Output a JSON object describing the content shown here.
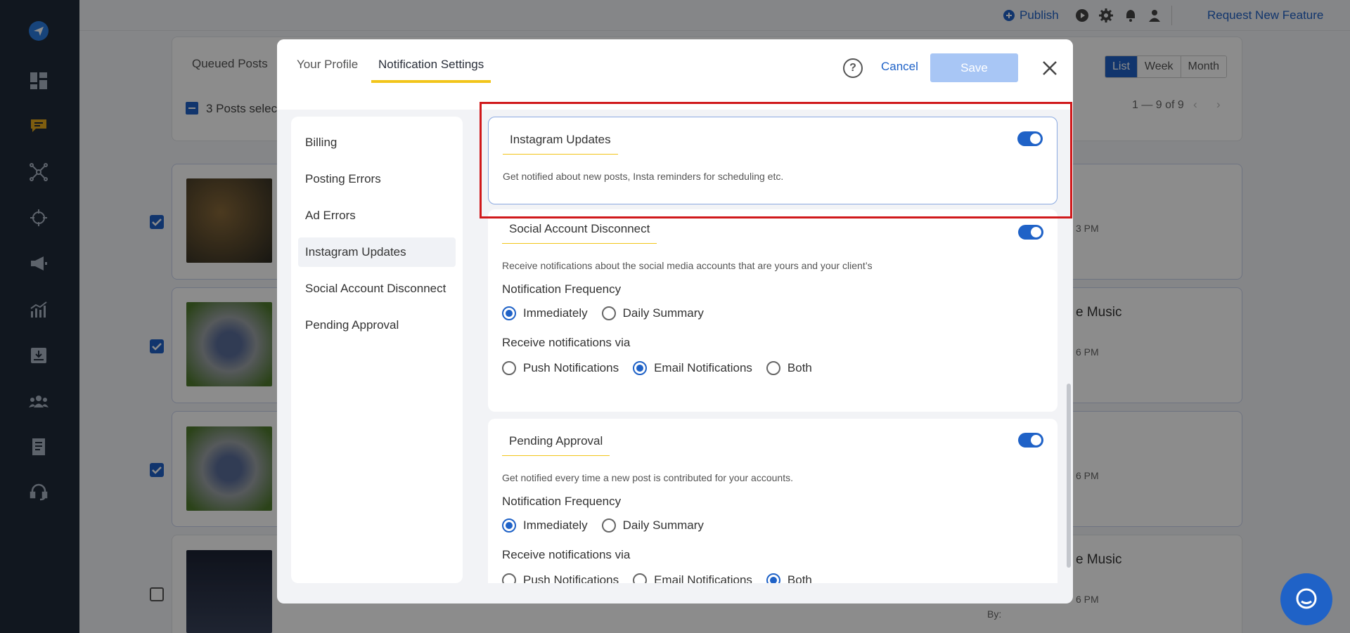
{
  "topbar": {
    "publish_label": "Publish",
    "request_feature_label": "Request New Feature"
  },
  "background": {
    "queued_posts_label": "Queued Posts",
    "posts_selected_label": "3 Posts selecte",
    "view_list": "List",
    "view_week": "Week",
    "view_month": "Month",
    "pagination": "1 — 9 of 9",
    "row_titles": [
      "e Music",
      "e Music"
    ],
    "row_times": [
      "3 PM",
      "6 PM",
      "6 PM",
      "6 PM"
    ],
    "by_label": "By:"
  },
  "modal": {
    "tabs": [
      "Your Profile",
      "Notification Settings"
    ],
    "help_label": "?",
    "cancel_label": "Cancel",
    "save_label": "Save",
    "nav": [
      "Billing",
      "Posting Errors",
      "Ad Errors",
      "Instagram Updates",
      "Social Account Disconnect",
      "Pending Approval"
    ],
    "instagram": {
      "title": "Instagram Updates",
      "desc": "Get notified about new posts, Insta reminders for scheduling etc.",
      "enabled": true
    },
    "social": {
      "title": "Social Account Disconnect",
      "desc": "Receive notifications about the social media accounts that are yours and your client’s",
      "freq_label": "Notification Frequency",
      "freq_options": [
        "Immediately",
        "Daily Summary"
      ],
      "via_label": "Receive notifications via",
      "via_options": [
        "Push Notifications",
        "Email Notifications",
        "Both"
      ],
      "enabled": true
    },
    "pending": {
      "title": "Pending Approval",
      "desc": "Get notified every time a new post is contributed for your accounts.",
      "freq_label": "Notification Frequency",
      "freq_options": [
        "Immediately",
        "Daily Summary"
      ],
      "via_label": "Receive notifications via",
      "via_options": [
        "Push Notifications",
        "Email Notifications",
        "Both"
      ],
      "enabled": true
    }
  },
  "colors": {
    "accent": "#1f62c7",
    "sidebar": "#1f2a3a",
    "tab_underline": "#f2c51a",
    "highlight": "#d0191b"
  }
}
